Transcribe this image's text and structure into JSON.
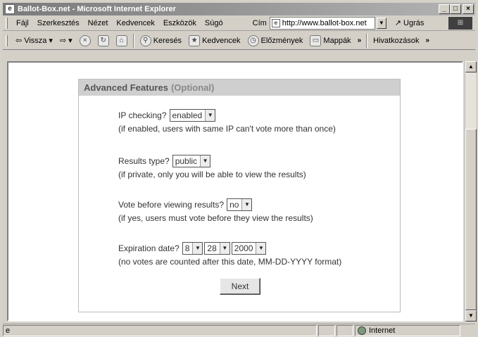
{
  "window": {
    "title": "Ballot-Box.net - Microsoft Internet Explorer"
  },
  "menu": {
    "items": [
      "Fájl",
      "Szerkesztés",
      "Nézet",
      "Kedvencek",
      "Eszközök",
      "Súgó"
    ],
    "address_label": "Cím",
    "address_value": "http://www.ballot-box.net",
    "go_label": "Ugrás"
  },
  "toolbar": {
    "back": "Vissza",
    "search": "Keresés",
    "favorites": "Kedvencek",
    "history": "Előzmények",
    "folders": "Mappák",
    "links": "Hivatkozások"
  },
  "panel": {
    "title": "Advanced Features",
    "subtitle": "(Optional)",
    "ip": {
      "label": "IP checking?",
      "value": "enabled",
      "hint": "(if enabled, users with same IP can't vote more than once)"
    },
    "results": {
      "label": "Results type?",
      "value": "public",
      "hint": "(if private, only you will be able to view the results)"
    },
    "vote": {
      "label": "Vote before viewing results?",
      "value": "no",
      "hint": "(if yes, users must vote before they view the results)"
    },
    "expiration": {
      "label": "Expiration date?",
      "month": "8",
      "day": "28",
      "year": "2000",
      "hint": "(no votes are counted after this date, MM-DD-YYYY format)"
    },
    "next": "Next"
  },
  "status": {
    "zone": "Internet"
  },
  "colors": {
    "title_gradient_start": "#7a7a7a",
    "panel_header": "#cfcfcf"
  }
}
